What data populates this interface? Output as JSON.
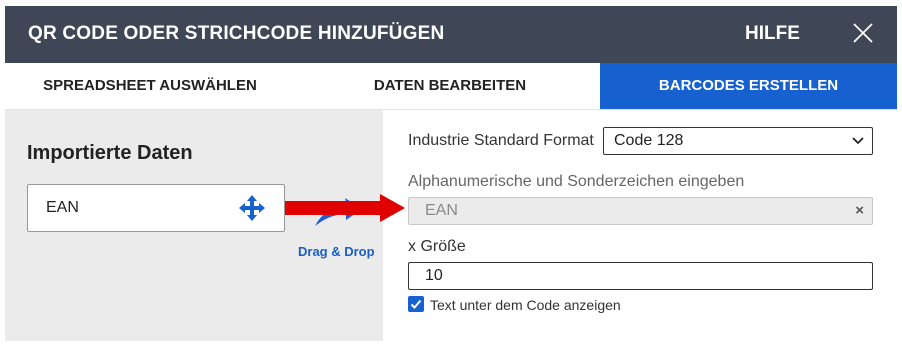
{
  "header": {
    "title": "QR CODE ODER STRICHCODE HINZUFÜGEN",
    "help": "HILFE"
  },
  "tabs": [
    {
      "label": "SPREADSHEET AUSWÄHLEN"
    },
    {
      "label": "DATEN BEARBEITEN"
    },
    {
      "label": "BARCODES ERSTELLEN"
    }
  ],
  "left": {
    "heading": "Importierte Daten",
    "field": "EAN",
    "drag_drop": "Drag & Drop"
  },
  "right": {
    "format_label": "Industrie Standard Format",
    "format_value": "Code 128",
    "data_label": "Alphanumerische und Sonderzeichen eingeben",
    "data_value": "EAN",
    "clear_glyph": "×",
    "size_label": "x Größe",
    "size_value": "10",
    "show_text_label": "Text unter dem Code anzeigen"
  },
  "colors": {
    "header_bg": "#3f4756",
    "accent": "#1760d0",
    "arrow": "#e10000"
  }
}
